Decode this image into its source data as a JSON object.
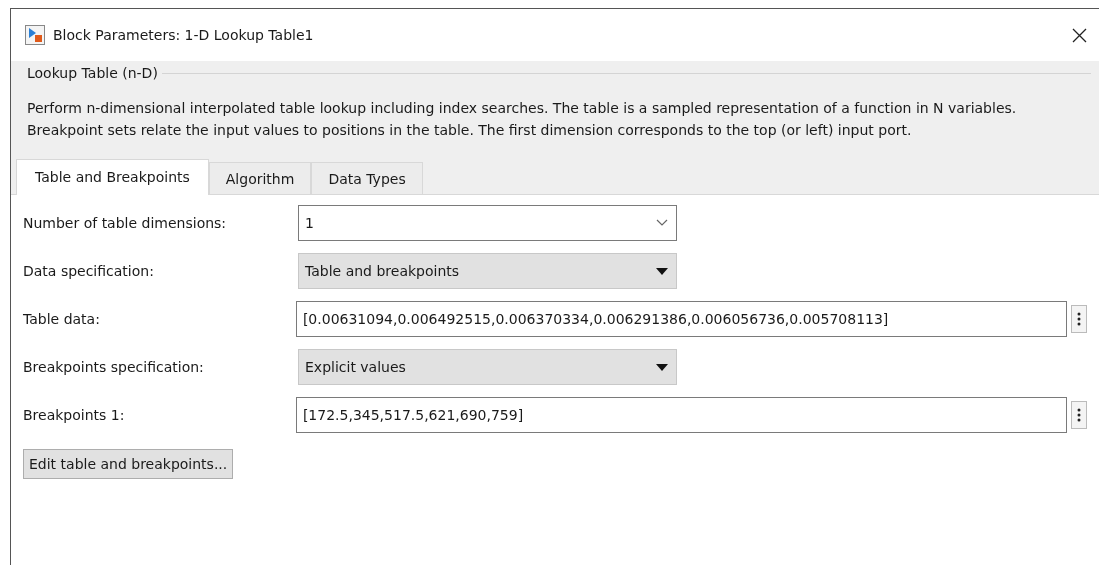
{
  "window": {
    "title": "Block Parameters: 1-D Lookup Table1"
  },
  "group": {
    "title": "Lookup Table (n-D)",
    "description": "Perform n-dimensional interpolated table lookup including index searches. The table is a sampled representation of a function in N variables. Breakpoint sets relate the input values to positions in the table. The first dimension corresponds to the top (or left) input port."
  },
  "tabs": [
    {
      "label": "Table and Breakpoints",
      "selected": true
    },
    {
      "label": "Algorithm",
      "selected": false
    },
    {
      "label": "Data Types",
      "selected": false
    }
  ],
  "parameters": [
    {
      "label": "Number of table dimensions:",
      "kind": "combo",
      "value": "1"
    },
    {
      "label": "Data specification:",
      "kind": "popup",
      "value": "Table and breakpoints"
    },
    {
      "label": "Table data:",
      "kind": "text",
      "value": "[0.00631094,0.006492515,0.006370334,0.006291386,0.006056736,0.005708113]"
    },
    {
      "label": "Breakpoints specification:",
      "kind": "popup",
      "value": "Explicit values"
    },
    {
      "label": "Breakpoints 1:",
      "kind": "text",
      "value": "[172.5,345,517.5,621,690,759]"
    }
  ],
  "buttons": [
    "Edit table and breakpoints..."
  ]
}
